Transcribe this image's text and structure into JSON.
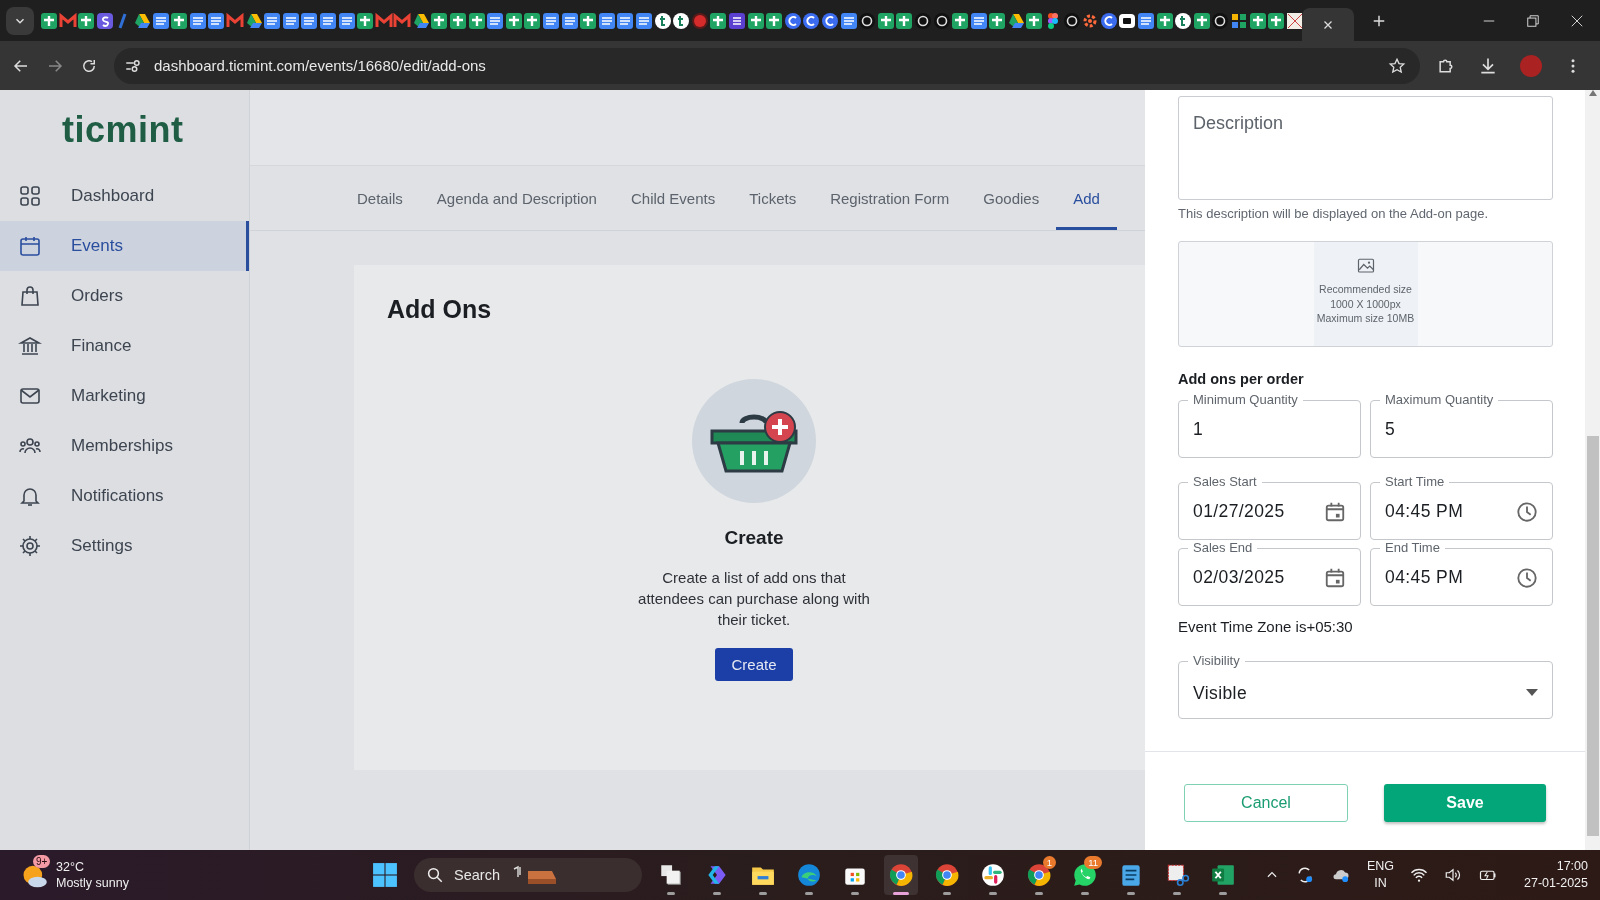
{
  "browser": {
    "url": "dashboard.ticmint.com/events/16680/edit/add-ons"
  },
  "sidebar": {
    "logo": "ticmint",
    "items": [
      {
        "label": "Dashboard",
        "selected": false
      },
      {
        "label": "Events",
        "selected": true
      },
      {
        "label": "Orders",
        "selected": false
      },
      {
        "label": "Finance",
        "selected": false
      },
      {
        "label": "Marketing",
        "selected": false
      },
      {
        "label": "Memberships",
        "selected": false
      },
      {
        "label": "Notifications",
        "selected": false
      },
      {
        "label": "Settings",
        "selected": false
      }
    ]
  },
  "tabs": [
    {
      "label": "Details",
      "selected": false
    },
    {
      "label": "Agenda and Description",
      "selected": false
    },
    {
      "label": "Child Events",
      "selected": false
    },
    {
      "label": "Tickets",
      "selected": false
    },
    {
      "label": "Registration Form",
      "selected": false
    },
    {
      "label": "Goodies",
      "selected": false
    },
    {
      "label": "Add",
      "selected": true
    }
  ],
  "content": {
    "title": "Add Ons",
    "empty_title": "Create",
    "empty_text": "Create a list of add ons that attendees can purchase along with their ticket.",
    "button": "Create"
  },
  "drawer": {
    "description": {
      "placeholder": "Description",
      "helper": "This description will be displayed on the Add-on page."
    },
    "upload": {
      "lines": [
        "Recommended size",
        "1000 X 1000px",
        "Maximum size 10MB"
      ]
    },
    "section": "Add ons per order",
    "fields": [
      {
        "label": "Minimum Quantity",
        "value": "1",
        "kind": "text"
      },
      {
        "label": "Maximum Quantity",
        "value": "5",
        "kind": "text"
      },
      {
        "label": "Sales Start",
        "value": "01/27/2025",
        "kind": "date"
      },
      {
        "label": "Start Time",
        "value": "04:45 PM",
        "kind": "time"
      },
      {
        "label": "Sales End",
        "value": "02/03/2025",
        "kind": "date"
      },
      {
        "label": "End Time",
        "value": "04:45 PM",
        "kind": "time"
      }
    ],
    "timezone": "Event Time Zone is+05:30",
    "visibility": {
      "label": "Visibility",
      "value": "Visible"
    },
    "cancel": "Cancel",
    "save": "Save"
  },
  "taskbar": {
    "weather": {
      "badge": "9+",
      "temp": "32°C",
      "text": "Mostly sunny"
    },
    "search": "Search",
    "apps": [
      {
        "selected": false
      },
      {
        "selected": false
      },
      {
        "selected": false
      },
      {
        "selected": false
      },
      {
        "selected": false
      },
      {
        "selected": true
      },
      {
        "selected": false
      },
      {
        "selected": false
      },
      {
        "selected": false,
        "badge": "1"
      },
      {
        "selected": false,
        "badge": "11"
      },
      {
        "selected": false
      },
      {
        "selected": false
      },
      {
        "selected": false
      }
    ],
    "language": "ENG",
    "region": "IN",
    "time": "17:00",
    "date": "27-01-2025"
  }
}
